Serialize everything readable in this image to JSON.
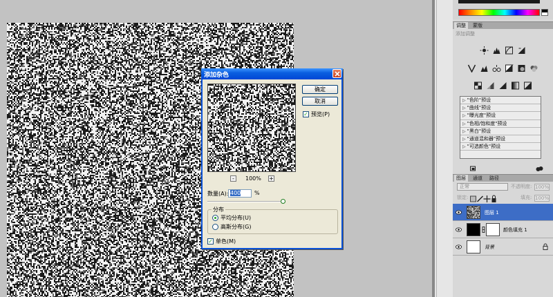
{
  "colors": {
    "dialog_title_blue": "#0a5fe0",
    "selected_layer_blue": "#3d6dc6",
    "checkmark_green": "#21a121"
  },
  "dialog": {
    "title": "添加杂色",
    "ok_label": "确定",
    "cancel_label": "取消",
    "preview_label": "预览(P)",
    "preview_checked": true,
    "zoom_out_label": "-",
    "zoom_level": "100%",
    "zoom_in_label": "+",
    "amount_label": "数量(A):",
    "amount_value": "400",
    "amount_unit": "%",
    "distribution_label": "分布",
    "uniform_label": "平均分布(U)",
    "gaussian_label": "高斯分布(G)",
    "selected_distribution": "uniform",
    "monochrome_label": "单色(M)",
    "monochrome_checked": true
  },
  "adjustments": {
    "tabs": [
      "调整",
      "蒙版"
    ],
    "subtitle": "添加调整",
    "presets": [
      "\"色阶\"预设",
      "\"曲线\"预设",
      "\"曝光度\"预设",
      "\"色相/饱和度\"预设",
      "\"黑白\"预设",
      "\"通道混和器\"预设",
      "\"可选颜色\"预设"
    ]
  },
  "layers_panel": {
    "tabs": [
      "图层",
      "通道",
      "路径"
    ],
    "blend_mode": "正常",
    "opacity_label": "不透明度:",
    "opacity_value": "100%",
    "lock_label": "锁定:",
    "fill_label": "填充:",
    "fill_value": "100%",
    "layers": [
      {
        "name": "图层 1",
        "selected": true
      },
      {
        "name": "颜色填充 1",
        "selected": false
      },
      {
        "name": "背景",
        "selected": false
      }
    ]
  }
}
